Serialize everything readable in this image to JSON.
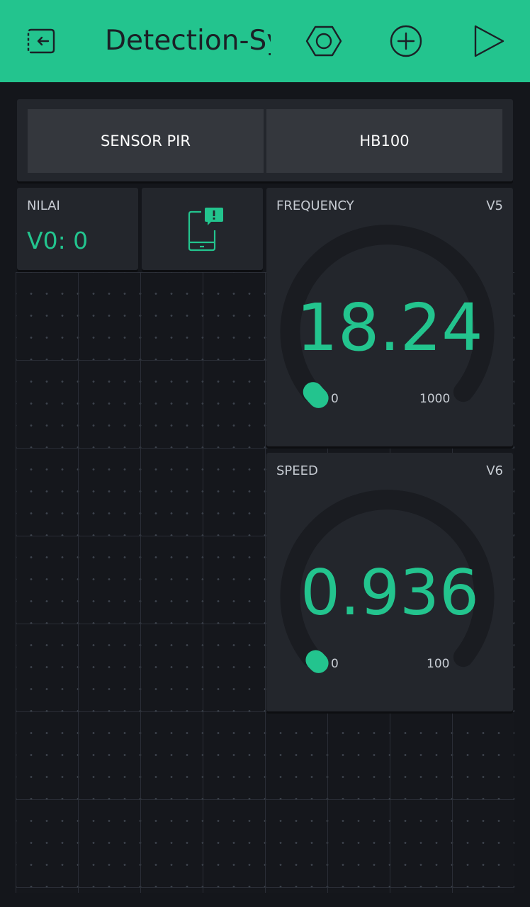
{
  "app": {
    "title": "Detection-System"
  },
  "topbar": {
    "back_icon": "exit-project-icon",
    "settings_icon": "hexagon-nut-icon",
    "add_icon": "plus-circle-icon",
    "play_icon": "play-icon"
  },
  "segmented_switch": {
    "options": [
      "SENSOR PIR",
      "HB100"
    ]
  },
  "value_display": {
    "label": "NILAI",
    "value": "V0: 0"
  },
  "notification": {
    "icon": "phone-notification-icon"
  },
  "gauges": [
    {
      "label": "FREQUENCY",
      "pin": "V5",
      "value": "18.24",
      "min": "0",
      "max": "1000",
      "level": 0.01824
    },
    {
      "label": "SPEED",
      "pin": "V6",
      "value": "0.936",
      "min": "0",
      "max": "100",
      "level": 0.00936
    }
  ],
  "colors": {
    "accent": "#23c48e",
    "background": "#14161b",
    "widget": "#23262c",
    "button": "#34373d"
  }
}
